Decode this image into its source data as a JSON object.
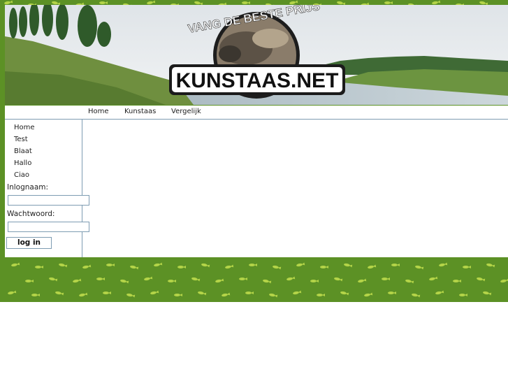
{
  "banner": {
    "tagline": "VANG DE BESTE PRIJS",
    "logo_text": "KUNSTAAS.NET"
  },
  "nav": {
    "items": [
      {
        "label": "Home"
      },
      {
        "label": "Kunstaas"
      },
      {
        "label": "Vergelijk"
      }
    ]
  },
  "sidebar": {
    "items": [
      {
        "label": "Home"
      },
      {
        "label": "Test"
      },
      {
        "label": "Blaat"
      },
      {
        "label": "Hallo"
      },
      {
        "label": "Ciao"
      }
    ],
    "login": {
      "username_label": "Inlognaam:",
      "username_value": "",
      "password_label": "Wachtwoord:",
      "password_value": "",
      "button_label": "log in"
    }
  },
  "colors": {
    "page_background": "#5c9125",
    "fish_pattern": "#b9d84a",
    "border": "#7e9cb2"
  }
}
